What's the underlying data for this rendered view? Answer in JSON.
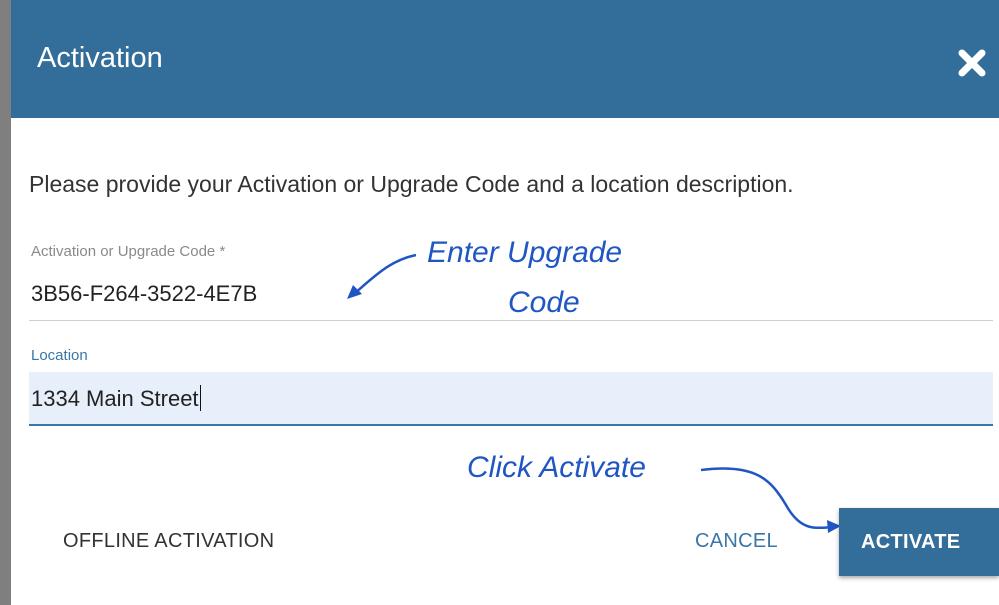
{
  "dialog": {
    "title": "Activation",
    "close_icon": "close-icon",
    "instruction": "Please provide your Activation or Upgrade Code and a location description.",
    "header_color": "#336d9a"
  },
  "fields": {
    "code": {
      "label": "Activation or Upgrade Code *",
      "value": "3B56-F264-3522-4E7B"
    },
    "location": {
      "label": "Location",
      "value": "1334 Main Street"
    }
  },
  "annotations": {
    "enter_code_line1": "Enter Upgrade",
    "enter_code_line2": "Code",
    "click_activate": "Click Activate",
    "color": "#1f56c3"
  },
  "buttons": {
    "offline": "OFFLINE ACTIVATION",
    "cancel": "CANCEL",
    "activate": "ACTIVATE"
  }
}
